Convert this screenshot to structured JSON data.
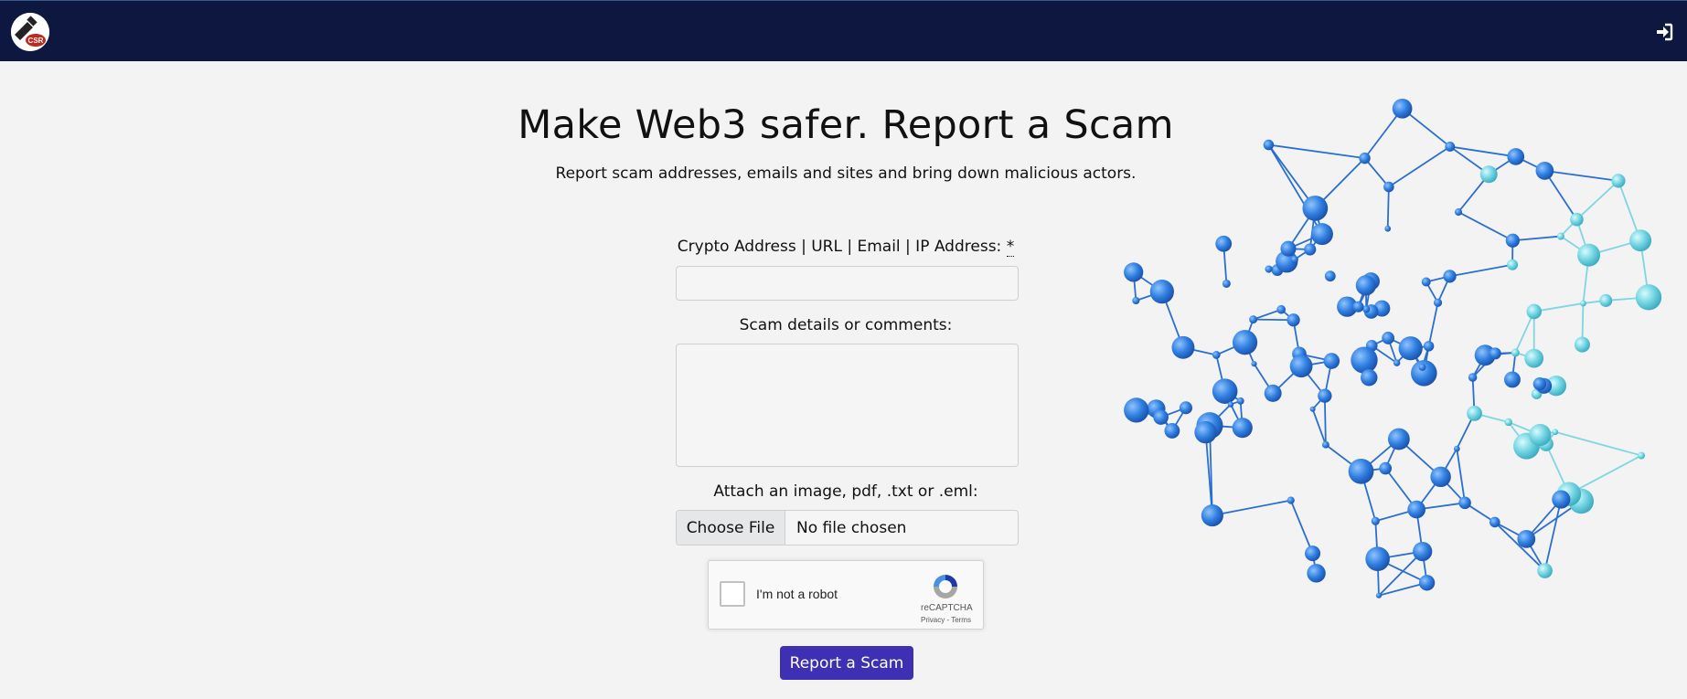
{
  "header": {
    "logo_name": "site-logo",
    "login_icon": "sign-in-icon",
    "background": "#0e1740"
  },
  "hero": {
    "title": "Make Web3 safer. Report a Scam",
    "subtitle": "Report scam addresses, emails and sites and bring down malicious actors."
  },
  "form": {
    "address_label": "Crypto Address | URL | Email | IP Address:",
    "required_marker": "*",
    "address_value": "",
    "details_label": "Scam details or comments:",
    "details_value": "",
    "attach_label": "Attach an image, pdf, .txt or .eml:",
    "file_button": "Choose File",
    "file_status": "No file chosen",
    "captcha_label": "I'm not a robot",
    "captcha_brand": "reCAPTCHA",
    "captcha_links": "Privacy - Terms",
    "submit_label": "Report a Scam",
    "accent": "#3f2fb3"
  }
}
